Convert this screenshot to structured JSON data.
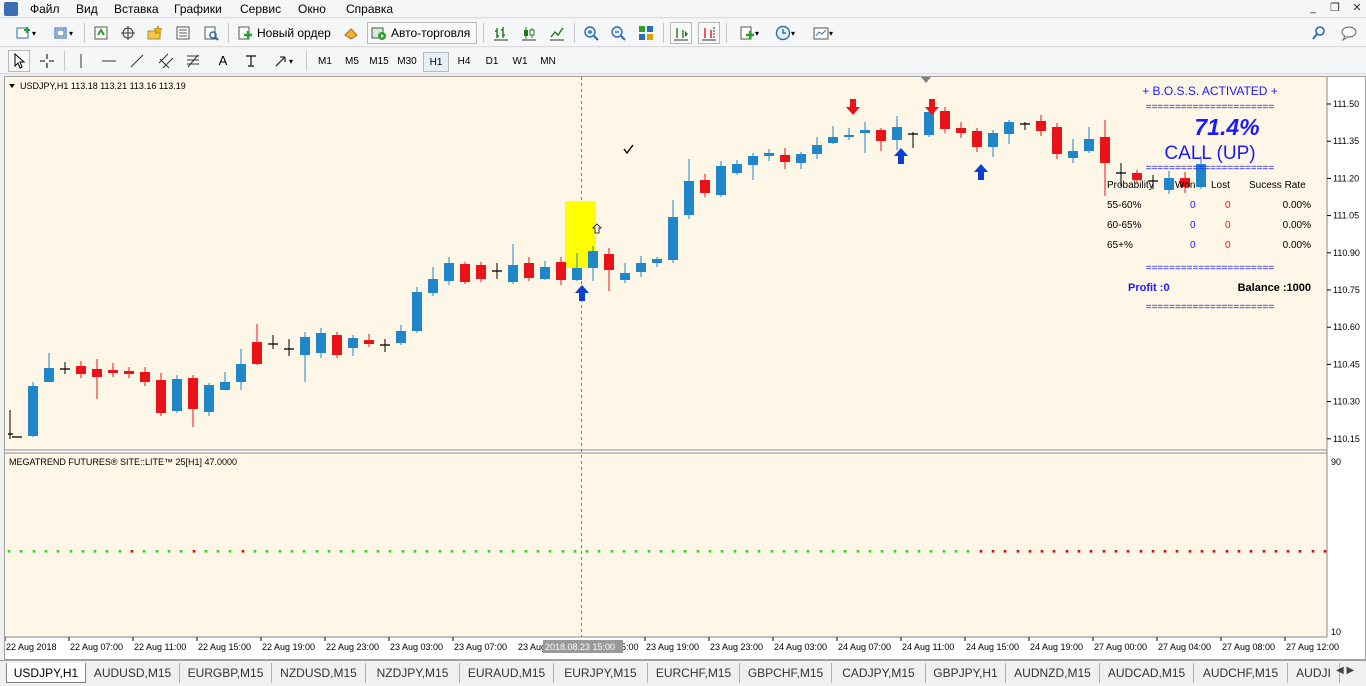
{
  "menu": {
    "items": [
      "Файл",
      "Вид",
      "Вставка",
      "Графики",
      "Сервис",
      "Окно",
      "Справка"
    ]
  },
  "toolbar": {
    "new_order_label": "Новый ордер",
    "auto_trade_label": "Авто-торговля"
  },
  "timeframes": [
    "M1",
    "M5",
    "M15",
    "M30",
    "H1",
    "H4",
    "D1",
    "W1",
    "MN"
  ],
  "active_timeframe": "H1",
  "chart": {
    "info": "USDJPY,H1  113.18 113.21 113.16 113.19",
    "indicator_label": "MEGATREND FUTURES®    SITE::LITE™  25[H1] 47.0000",
    "price_ticks": [
      "111.50",
      "111.35",
      "111.20",
      "111.05",
      "110.90",
      "110.75",
      "110.60",
      "110.45",
      "110.30",
      "110.15"
    ],
    "indicator_ticks": [
      "90",
      "10"
    ],
    "time_ticks": [
      "22 Aug 2018",
      "22 Aug 07:00",
      "22 Aug 11:00",
      "22 Aug 15:00",
      "22 Aug 19:00",
      "22 Aug 23:00",
      "23 Aug 03:00",
      "23 Aug 07:00",
      "23 Aug",
      "5:00",
      "23 Aug 19:00",
      "23 Aug 23:00",
      "24 Aug 03:00",
      "24 Aug 07:00",
      "24 Aug 11:00",
      "24 Aug 15:00",
      "24 Aug 19:00",
      "27 Aug 00:00",
      "27 Aug 04:00",
      "27 Aug 08:00",
      "27 Aug 12:00"
    ],
    "crosshair_time": "2018.08.23 15:00",
    "colors": {
      "bull": "#1f86c8",
      "bear": "#e8141a",
      "highlight": "#ffff00",
      "bg": "#fef6e6"
    }
  },
  "boss_panel": {
    "title": "+ B.O.S.S. ACTIVATED +",
    "separator": "======================",
    "percent": "71.4%",
    "signal": "CALL (UP)",
    "headers": [
      "Probability",
      "Won",
      "Lost",
      "Sucess Rate"
    ],
    "rows": [
      {
        "range": "55-60%",
        "won": "0",
        "lost": "0",
        "rate": "0.00%"
      },
      {
        "range": "60-65%",
        "won": "0",
        "lost": "0",
        "rate": "0.00%"
      },
      {
        "range": "65+%",
        "won": "0",
        "lost": "0",
        "rate": "0.00%"
      }
    ],
    "profit": "Profit :0",
    "balance": "Balance :1000"
  },
  "tabs": [
    "USDJPY,H1",
    "AUDUSD,M15",
    "EURGBP,M15",
    "NZDUSD,M15",
    "NZDJPY,M15",
    "EURAUD,M15",
    "EURJPY,M15",
    "EURCHF,M15",
    "GBPCHF,M15",
    "CADJPY,M15",
    "GBPJPY,H1",
    "AUDNZD,M15",
    "AUDCAD,M15",
    "AUDCHF,M15",
    "AUDJI"
  ],
  "active_tab": "USDJPY,H1"
}
